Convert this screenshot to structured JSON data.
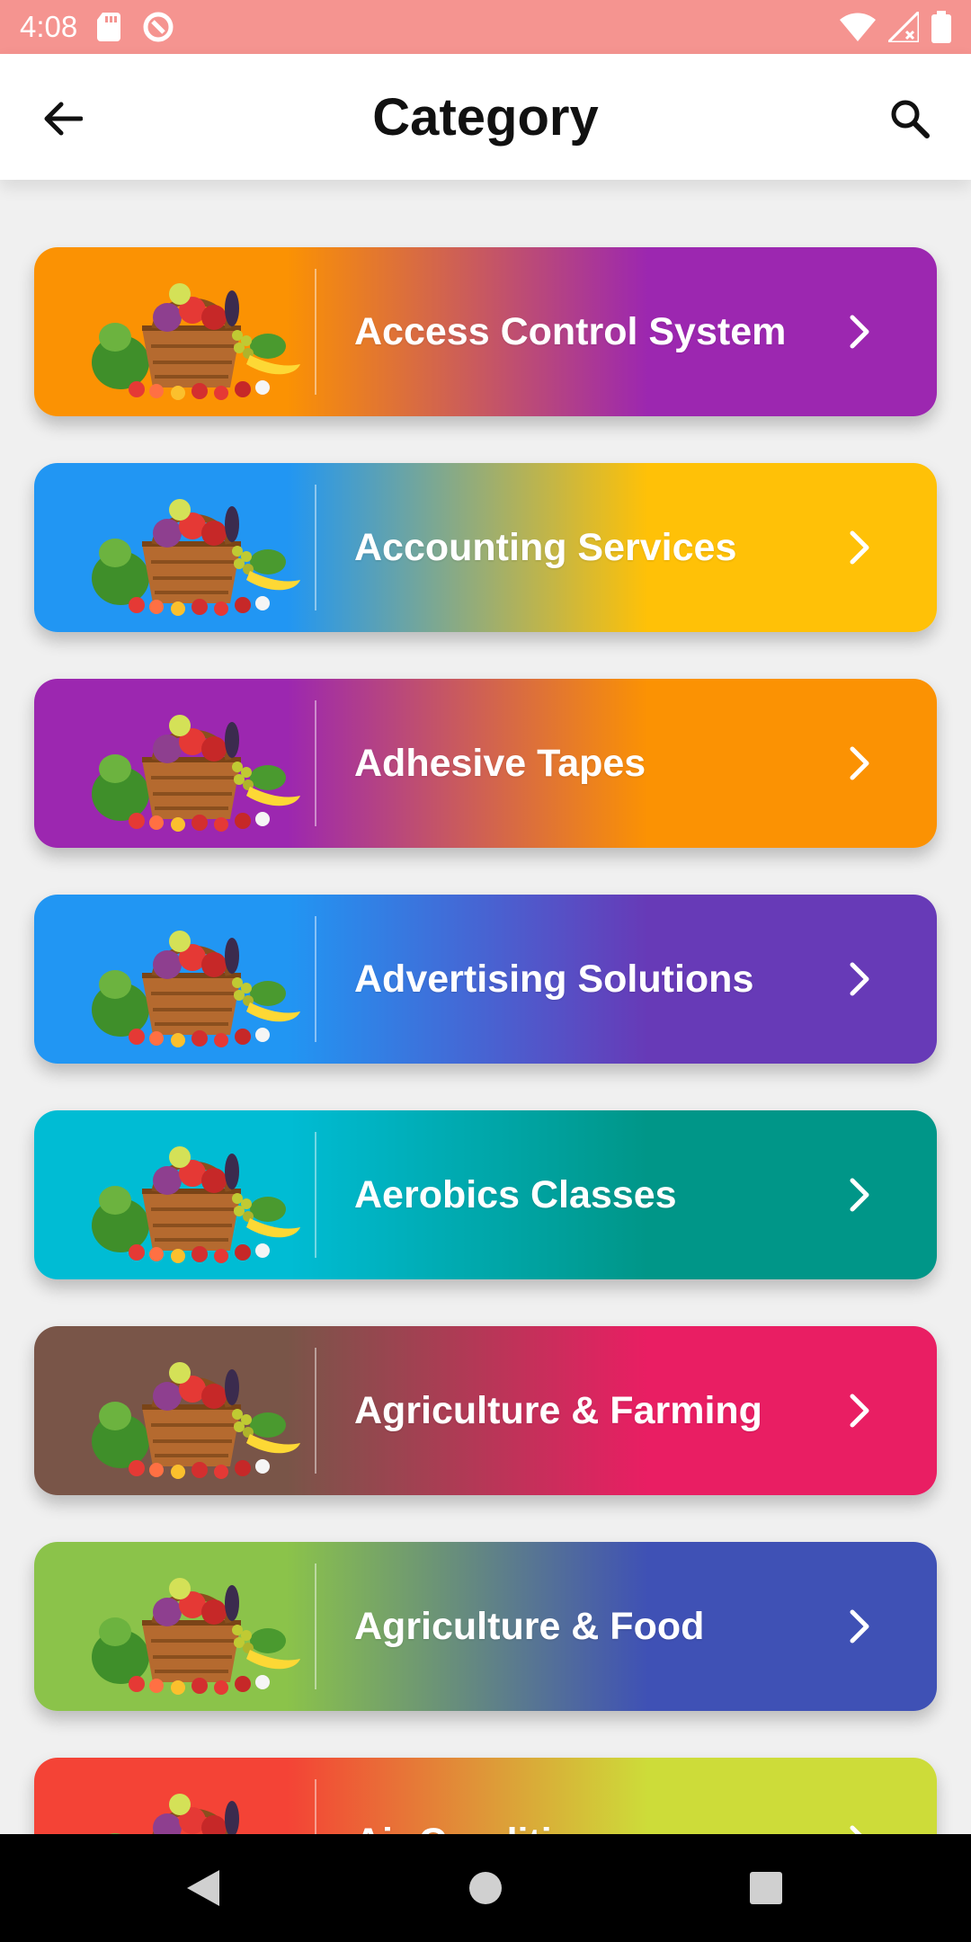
{
  "status_bar": {
    "time": "4:08",
    "icons": [
      "sd-card-icon",
      "sync-circle-icon",
      "wifi-icon",
      "signal-icon",
      "battery-icon"
    ]
  },
  "app_bar": {
    "title": "Category",
    "back_icon": "back-arrow-icon",
    "search_icon": "search-icon"
  },
  "categories": [
    {
      "label": "Access Control System",
      "gradient": [
        "#fb9203",
        "#9c27b0"
      ]
    },
    {
      "label": "Accounting Services",
      "gradient": [
        "#2196f3",
        "#ffc107"
      ]
    },
    {
      "label": "Adhesive Tapes",
      "gradient": [
        "#9c27b0",
        "#fb9203"
      ]
    },
    {
      "label": "Advertising Solutions",
      "gradient": [
        "#2196f3",
        "#673ab7"
      ]
    },
    {
      "label": "Aerobics Classes",
      "gradient": [
        "#00bcd4",
        "#009688"
      ]
    },
    {
      "label": "Agriculture & Farming",
      "gradient": [
        "#795548",
        "#e91e63"
      ]
    },
    {
      "label": "Agriculture & Food",
      "gradient": [
        "#8bc34a",
        "#3f51b5"
      ]
    },
    {
      "label": "Air Conditi...",
      "gradient": [
        "#f44336",
        "#cddc39"
      ]
    }
  ],
  "nav_bar": {
    "icons": [
      "back-triangle-icon",
      "home-circle-icon",
      "recents-square-icon"
    ]
  },
  "colors": {
    "status_bar_bg": "#f59490",
    "background": "#f0f0f0"
  }
}
